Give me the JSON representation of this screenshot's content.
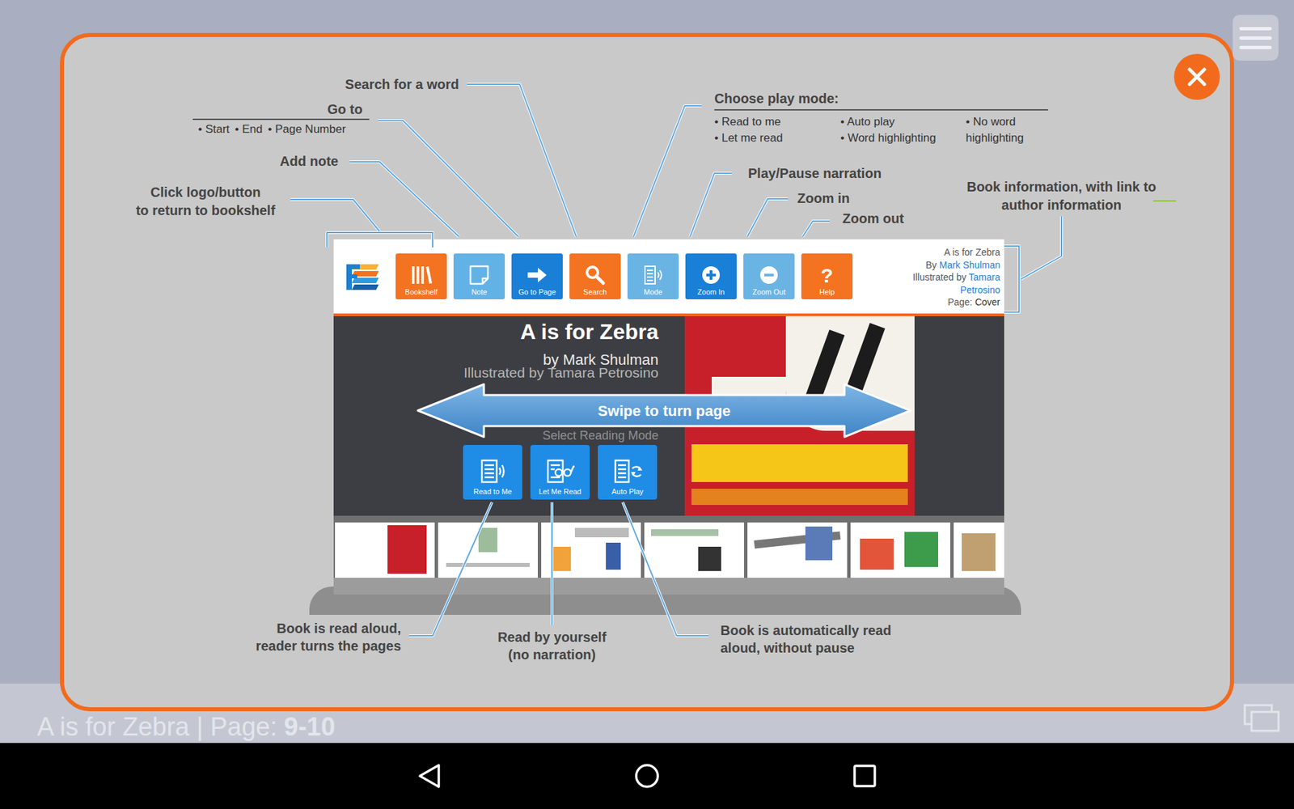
{
  "help_overlay": {
    "callouts": {
      "search": "Search for a word",
      "go_to": {
        "title": "Go to",
        "options": [
          "• Start",
          "• End",
          "• Page Number"
        ]
      },
      "add_note": "Add note",
      "bookshelf": [
        "Click logo/button",
        "to return to bookshelf"
      ],
      "play_mode": {
        "title": "Choose play mode:",
        "options": [
          "• Read to me",
          "• Let me read",
          "• Auto play",
          "• Word highlighting",
          "• No word highlighting"
        ]
      },
      "play_pause": "Play/Pause narration",
      "zoom_in": "Zoom in",
      "zoom_out": "Zoom out",
      "book_info": [
        "Book information, with link to",
        "author information"
      ]
    },
    "mode_notes": [
      [
        "Book is read aloud,",
        "reader turns the pages"
      ],
      [
        "Read by yourself",
        "(no narration)"
      ],
      [
        "Book is automatically read",
        "aloud, without pause"
      ]
    ],
    "swipe_hint": "Swipe to turn page"
  },
  "toolbar": {
    "buttons": [
      {
        "label": "Bookshelf",
        "color": "#f47321"
      },
      {
        "label": "Note",
        "color": "#62b2e6"
      },
      {
        "label": "Go to Page",
        "color": "#1a7fd6"
      },
      {
        "label": "Search",
        "color": "#f47321"
      },
      {
        "label": "Mode",
        "color": "#6ab4e4"
      },
      {
        "label": "Zoom In",
        "color": "#1a7fd6"
      },
      {
        "label": "Zoom Out",
        "color": "#6ab4e4"
      },
      {
        "label": "Help",
        "color": "#f47321",
        "glyph": "?"
      }
    ]
  },
  "book_info": {
    "title": "A is for Zebra",
    "by": "By ",
    "author": "Mark Shulman",
    "illustrated": "Illustrated by ",
    "illustrator": "Tamara Petrosino",
    "page_label": "Page: ",
    "page": "Cover"
  },
  "page": {
    "title": "A is for Zebra",
    "author_line": "by Mark Shulman",
    "illustrator_line": "Illustrated by Tamara Petrosino",
    "select_label": "Select Reading Mode",
    "modes": [
      {
        "label": "Read to Me"
      },
      {
        "label": "Let Me Read"
      },
      {
        "label": "Auto Play"
      }
    ]
  },
  "status_bar": {
    "title": "A is for Zebra | Page:",
    "page": "9-10"
  }
}
